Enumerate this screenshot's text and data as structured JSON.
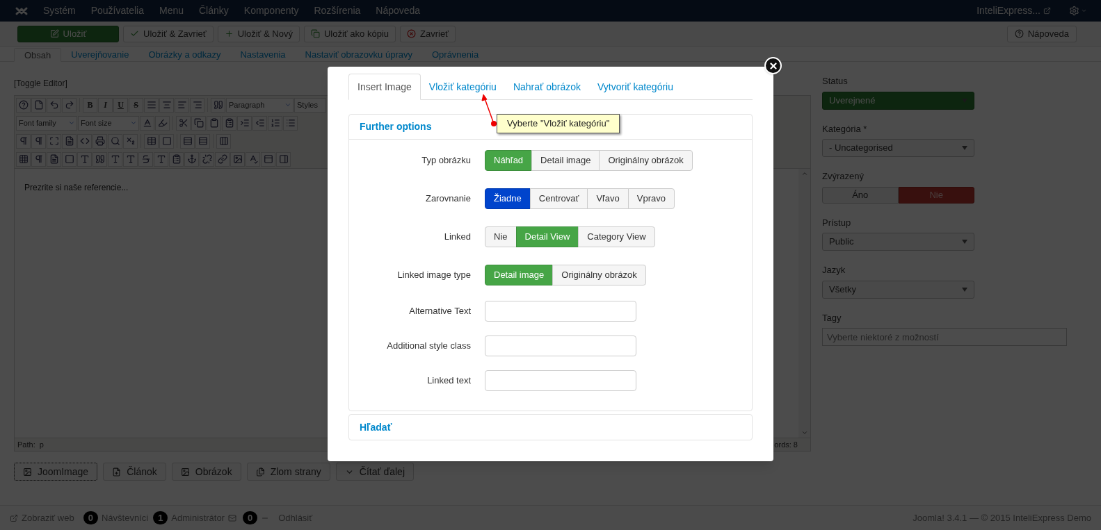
{
  "top_nav": {
    "menu": [
      "Systém",
      "Používatelia",
      "Menu",
      "Články",
      "Komponenty",
      "Rozšírenia",
      "Nápoveda"
    ],
    "site_link": "InteliExpress..."
  },
  "toolbar": {
    "buttons": [
      {
        "label": "Uložiť",
        "kind": "primary"
      },
      {
        "label": "Uložiť & Zavrieť",
        "kind": "default"
      },
      {
        "label": "Uložiť & Nový",
        "kind": "default"
      },
      {
        "label": "Uložiť ako kópiu",
        "kind": "default"
      },
      {
        "label": "Zavrieť",
        "kind": "default"
      }
    ],
    "help": "Nápoveda"
  },
  "tabs": [
    {
      "label": "Obsah",
      "selected": true
    },
    {
      "label": "Uverejňovanie",
      "selected": false
    },
    {
      "label": "Obrázky a odkazy",
      "selected": false
    },
    {
      "label": "Nastavenia",
      "selected": false
    },
    {
      "label": "Nastaviť obrazovku úpravy",
      "selected": false
    },
    {
      "label": "Oprávnenia",
      "selected": false
    }
  ],
  "editor": {
    "toggle": "[Toggle Editor]",
    "text_buttons": [
      "B",
      "I",
      "U",
      "S"
    ],
    "selects": [
      "Paragraph",
      "Styles",
      "Font family",
      "Font size"
    ],
    "content": "Prezrite si naše referencie...",
    "path_label": "Path:",
    "path": "p",
    "word_count": "ords: 8"
  },
  "insert_buttons": [
    {
      "label": "JoomImage",
      "focused": true
    },
    {
      "label": "Článok",
      "focused": false
    },
    {
      "label": "Obrázok",
      "focused": false
    },
    {
      "label": "Zlom strany",
      "focused": false
    },
    {
      "label": "Čítať ďalej",
      "focused": false
    }
  ],
  "sidebar": [
    {
      "kind": "status",
      "label": "Status",
      "value": "Uverejnené"
    },
    {
      "kind": "select",
      "label": "Kategória *",
      "value": "- Uncategorised"
    },
    {
      "kind": "toggle",
      "label": "Zvýrazený",
      "options": [
        {
          "label": "Áno",
          "selected": false
        },
        {
          "label": "Nie",
          "selected": true
        }
      ]
    },
    {
      "kind": "select",
      "label": "Prístup",
      "value": "Public"
    },
    {
      "kind": "select",
      "label": "Jazyk",
      "value": "Všetky"
    },
    {
      "kind": "tags",
      "label": "Tagy",
      "placeholder": "Vyberte niektoré z možností"
    }
  ],
  "footer": {
    "view_site": "Zobraziť web",
    "visitors": {
      "count": "0",
      "label": "Návštevníci"
    },
    "admins": {
      "count": "1",
      "label": "Administrátor"
    },
    "messages": {
      "count": "0"
    },
    "logout": "Odhlásiť",
    "copyright": "Joomla! 3.4.1 — © 2015 InteliExpress Demo"
  },
  "modal": {
    "tabs": [
      {
        "label": "Insert Image",
        "selected": true
      },
      {
        "label": "Vložiť kategóriu",
        "selected": false
      },
      {
        "label": "Nahrať obrázok",
        "selected": false
      },
      {
        "label": "Vytvoriť kategóriu",
        "selected": false
      }
    ],
    "tooltip": "Vyberte \"Vložiť kategóriu\"",
    "panels": [
      {
        "title": "Further options",
        "expanded": true,
        "rows": [
          {
            "kind": "buttons",
            "label": "Typ obrázku",
            "options": [
              {
                "label": "Náhľad",
                "selected": true
              },
              {
                "label": "Detail image",
                "selected": false
              },
              {
                "label": "Originálny obrázok",
                "selected": false
              }
            ]
          },
          {
            "kind": "buttons",
            "label": "Zarovnanie",
            "options": [
              {
                "label": "Žiadne",
                "selected": true
              },
              {
                "label": "Centrovať",
                "selected": false
              },
              {
                "label": "Vľavo",
                "selected": false
              },
              {
                "label": "Vpravo",
                "selected": false
              }
            ]
          },
          {
            "kind": "buttons",
            "label": "Linked",
            "options": [
              {
                "label": "Nie",
                "selected": false
              },
              {
                "label": "Detail View",
                "selected": true
              },
              {
                "label": "Category View",
                "selected": false
              }
            ]
          },
          {
            "kind": "buttons",
            "label": "Linked image type",
            "options": [
              {
                "label": "Detail image",
                "selected": true
              },
              {
                "label": "Originálny obrázok",
                "selected": false
              }
            ]
          },
          {
            "kind": "input",
            "label": "Alternative Text"
          },
          {
            "kind": "input",
            "label": "Additional style class"
          },
          {
            "kind": "input",
            "label": "Linked text"
          }
        ]
      },
      {
        "title": "Hľadať",
        "expanded": false
      }
    ]
  }
}
